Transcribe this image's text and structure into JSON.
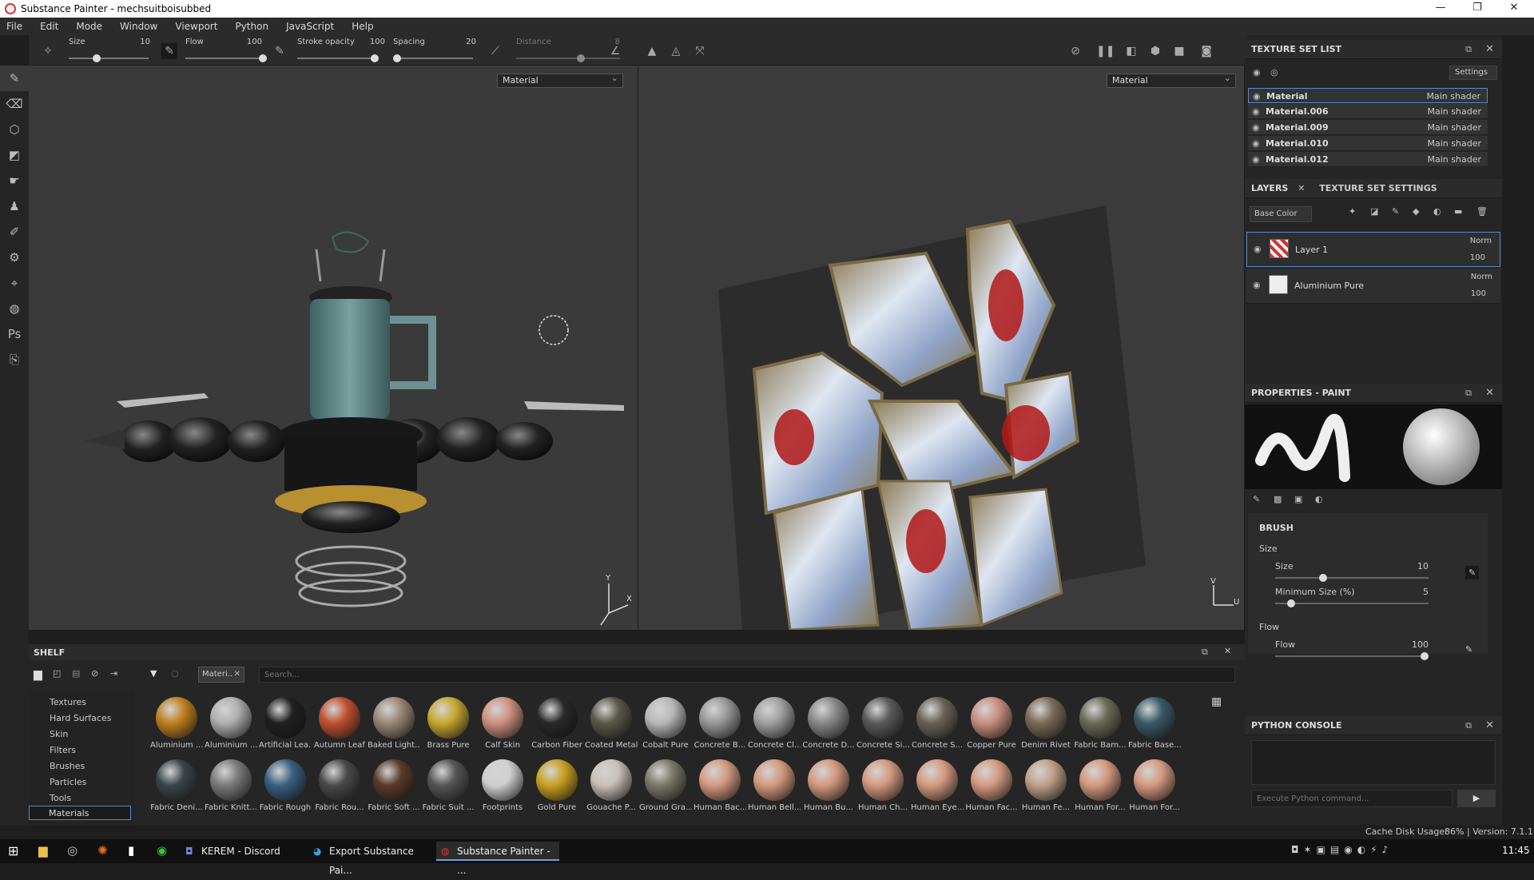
{
  "app": {
    "title": "Substance Painter - mechsuitboisubbed",
    "window_controls": [
      "—",
      "❐",
      "✕"
    ]
  },
  "menu": [
    "File",
    "Edit",
    "Mode",
    "Window",
    "Viewport",
    "Python",
    "JavaScript",
    "Help"
  ],
  "toolbar": {
    "size_label": "Size",
    "size_value": "10",
    "flow_label": "Flow",
    "flow_value": "100",
    "stroke_label": "Stroke opacity",
    "stroke_value": "100",
    "spacing_label": "Spacing",
    "spacing_value": "20",
    "distance_label": "Distance",
    "distance_value": "8"
  },
  "viewport": {
    "left_channel": "Material",
    "right_channel": "Material",
    "axis_y": "Y",
    "axis_x": "X",
    "uv_v": "V",
    "uv_u": "U"
  },
  "texture_set_list": {
    "title": "TEXTURE SET LIST",
    "settings_label": "Settings",
    "rows": [
      {
        "name": "Material",
        "shader": "Main shader"
      },
      {
        "name": "Material.006",
        "shader": "Main shader"
      },
      {
        "name": "Material.009",
        "shader": "Main shader"
      },
      {
        "name": "Material.010",
        "shader": "Main shader"
      },
      {
        "name": "Material.012",
        "shader": "Main shader"
      }
    ]
  },
  "layers": {
    "tab_layers": "LAYERS",
    "tab_tss": "TEXTURE SET SETTINGS",
    "channel": "Base Color",
    "items": [
      {
        "name": "Layer 1",
        "blend": "Norm",
        "opacity": "100"
      },
      {
        "name": "Aluminium Pure",
        "blend": "Norm",
        "opacity": "100"
      }
    ]
  },
  "properties": {
    "title": "PROPERTIES - PAINT",
    "section": "BRUSH",
    "size_group": "Size",
    "size_label": "Size",
    "size_value": "10",
    "min_size_label": "Minimum Size (%)",
    "min_size_value": "5",
    "flow_group": "Flow",
    "flow_label": "Flow",
    "flow_value": "100",
    "size_fill": 0.3,
    "min_fill": 0.08,
    "flow_fill": 1.0
  },
  "python_console": {
    "title": "PYTHON CONSOLE",
    "placeholder": "Execute Python command..."
  },
  "shelf": {
    "title": "SHELF",
    "filter_tag": "Materi..",
    "search_placeholder": "Search...",
    "categories": [
      "Textures",
      "Hard Surfaces",
      "Skin",
      "Filters",
      "Brushes",
      "Particles",
      "Tools",
      "Materials"
    ],
    "selected_category": "Materials",
    "materials_row1": [
      {
        "n": "Aluminium ...",
        "c": "#c08020"
      },
      {
        "n": "Aluminium ...",
        "c": "#b0b0b0"
      },
      {
        "n": "Artificial Lea...",
        "c": "#202020"
      },
      {
        "n": "Autumn Leaf",
        "c": "#c05030"
      },
      {
        "n": "Baked Light...",
        "c": "#9a8878"
      },
      {
        "n": "Brass Pure",
        "c": "#c8a830"
      },
      {
        "n": "Calf Skin",
        "c": "#d09080"
      },
      {
        "n": "Carbon Fiber",
        "c": "#282828"
      },
      {
        "n": "Coated Metal",
        "c": "#5a5848"
      },
      {
        "n": "Cobalt Pure",
        "c": "#b8b8b8"
      },
      {
        "n": "Concrete B...",
        "c": "#989898"
      },
      {
        "n": "Concrete Cl...",
        "c": "#a0a0a0"
      },
      {
        "n": "Concrete D...",
        "c": "#888888"
      },
      {
        "n": "Concrete Si...",
        "c": "#5a5a5a"
      },
      {
        "n": "Concrete S...",
        "c": "#6a6258"
      },
      {
        "n": "Copper Pure",
        "c": "#c89080"
      },
      {
        "n": "Denim Rivet",
        "c": "#7a6a58"
      },
      {
        "n": "Fabric Bam...",
        "c": "#6a6a58"
      },
      {
        "n": "Fabric Base...",
        "c": "#3a5a68"
      }
    ],
    "materials_row2": [
      {
        "n": "Fabric Deni...",
        "c": "#3a4448"
      },
      {
        "n": "Fabric Knitt...",
        "c": "#7a7a7a"
      },
      {
        "n": "Fabric Rough",
        "c": "#3a6080"
      },
      {
        "n": "Fabric Rou...",
        "c": "#4a4a4a"
      },
      {
        "n": "Fabric Soft ...",
        "c": "#5a3a2a"
      },
      {
        "n": "Fabric Suit ...",
        "c": "#555555"
      },
      {
        "n": "Footprints",
        "c": "#d0d0d0"
      },
      {
        "n": "Gold Pure",
        "c": "#c8a020"
      },
      {
        "n": "Gouache P...",
        "c": "#c8c0b8"
      },
      {
        "n": "Ground Gra...",
        "c": "#7a7868"
      },
      {
        "n": "Human Bac...",
        "c": "#d49a80"
      },
      {
        "n": "Human Bell...",
        "c": "#d49a80"
      },
      {
        "n": "Human Bu...",
        "c": "#d49a80"
      },
      {
        "n": "Human Ch...",
        "c": "#d49a80"
      },
      {
        "n": "Human Eye...",
        "c": "#d49a80"
      },
      {
        "n": "Human Fac...",
        "c": "#d49a80"
      },
      {
        "n": "Human Fe...",
        "c": "#c0a088"
      },
      {
        "n": "Human For...",
        "c": "#d49a80"
      },
      {
        "n": "Human For...",
        "c": "#d49a80"
      }
    ]
  },
  "status": {
    "cache": "Cache Disk Usage:",
    "cache_value": "86%",
    "version": "| Version: 7.1.1"
  },
  "taskbar": {
    "items": [
      "KEREM - Discord",
      "Export Substance Pai...",
      "Substance Painter - ..."
    ],
    "clock": "11:45"
  }
}
